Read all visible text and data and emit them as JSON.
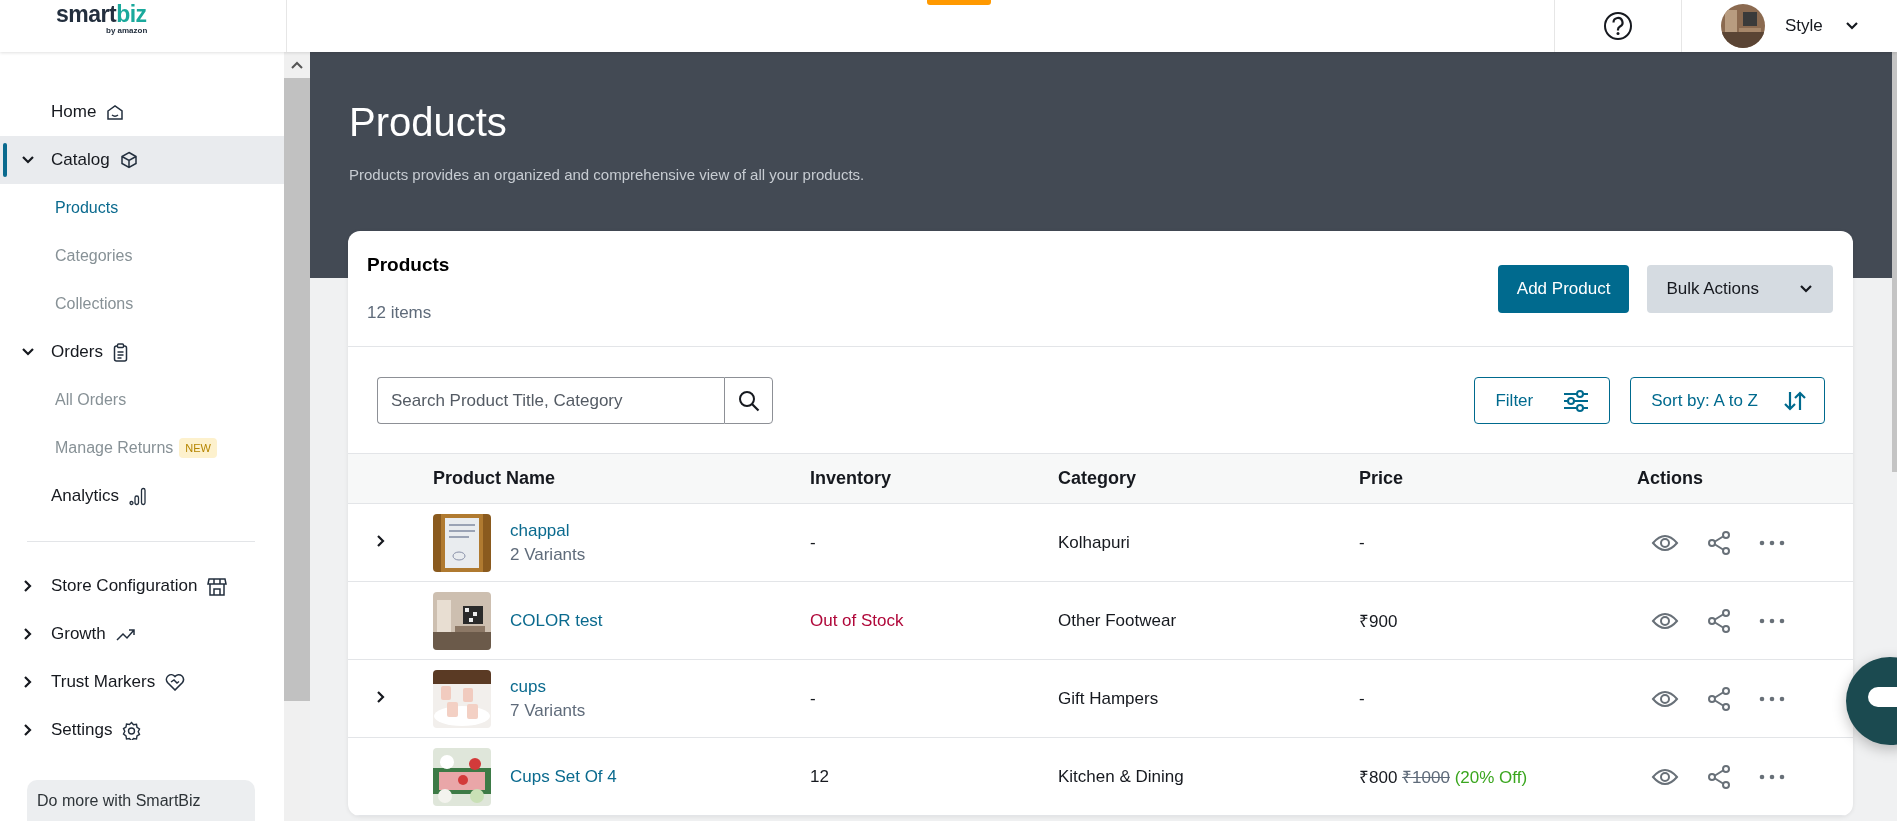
{
  "topbar": {
    "logo": {
      "primary": "smart",
      "accent": "biz",
      "tagline": "by amazon"
    },
    "user": {
      "name": "Style"
    }
  },
  "sidebar": {
    "items": [
      {
        "label": "Home",
        "selected": false
      },
      {
        "label": "Catalog",
        "selected": true,
        "expanded": true,
        "children": [
          {
            "label": "Products",
            "selected": true
          },
          {
            "label": "Categories",
            "selected": false
          },
          {
            "label": "Collections",
            "selected": false
          }
        ]
      },
      {
        "label": "Orders",
        "selected": false,
        "expanded": true,
        "children": [
          {
            "label": "All Orders",
            "selected": false
          },
          {
            "label": "Manage Returns",
            "selected": false,
            "badge": "NEW"
          }
        ]
      },
      {
        "label": "Analytics",
        "selected": false
      }
    ],
    "more_items": [
      {
        "label": "Store Configuration",
        "expanded": false
      },
      {
        "label": "Growth",
        "expanded": false
      },
      {
        "label": "Trust Markers",
        "expanded": false
      },
      {
        "label": "Settings",
        "expanded": false
      }
    ],
    "promo": "Do more with SmartBiz"
  },
  "page": {
    "title": "Products",
    "description": "Products provides an organized and comprehensive view of all your products."
  },
  "products": {
    "title": "Products",
    "count": "12 items",
    "add_button": "Add Product",
    "bulk_button": "Bulk Actions",
    "search": {
      "placeholder": "Search Product Title, Category"
    },
    "filter": "Filter",
    "sort": "Sort by: A to Z",
    "columns": [
      "Product Name",
      "Inventory",
      "Category",
      "Price",
      "Actions"
    ],
    "rows": [
      {
        "name": "chappal",
        "variants": "2 Variants",
        "expanded": false,
        "inventory": "-",
        "out_of_stock": false,
        "category": "Kolhapuri",
        "price": "-"
      },
      {
        "name": "COLOR test",
        "inventory": "Out of Stock",
        "out_of_stock": true,
        "category": "Other Footwear",
        "price": "₹900"
      },
      {
        "name": "cups",
        "variants": "7 Variants",
        "expanded": false,
        "inventory": "-",
        "out_of_stock": false,
        "category": "Gift Hampers",
        "price": "-"
      },
      {
        "name": "Cups Set Of 4",
        "inventory": "12",
        "out_of_stock": false,
        "category": "Kitchen & Dining",
        "price": "₹800",
        "original_price": "₹1000",
        "discount": "(20% Off)"
      }
    ]
  }
}
